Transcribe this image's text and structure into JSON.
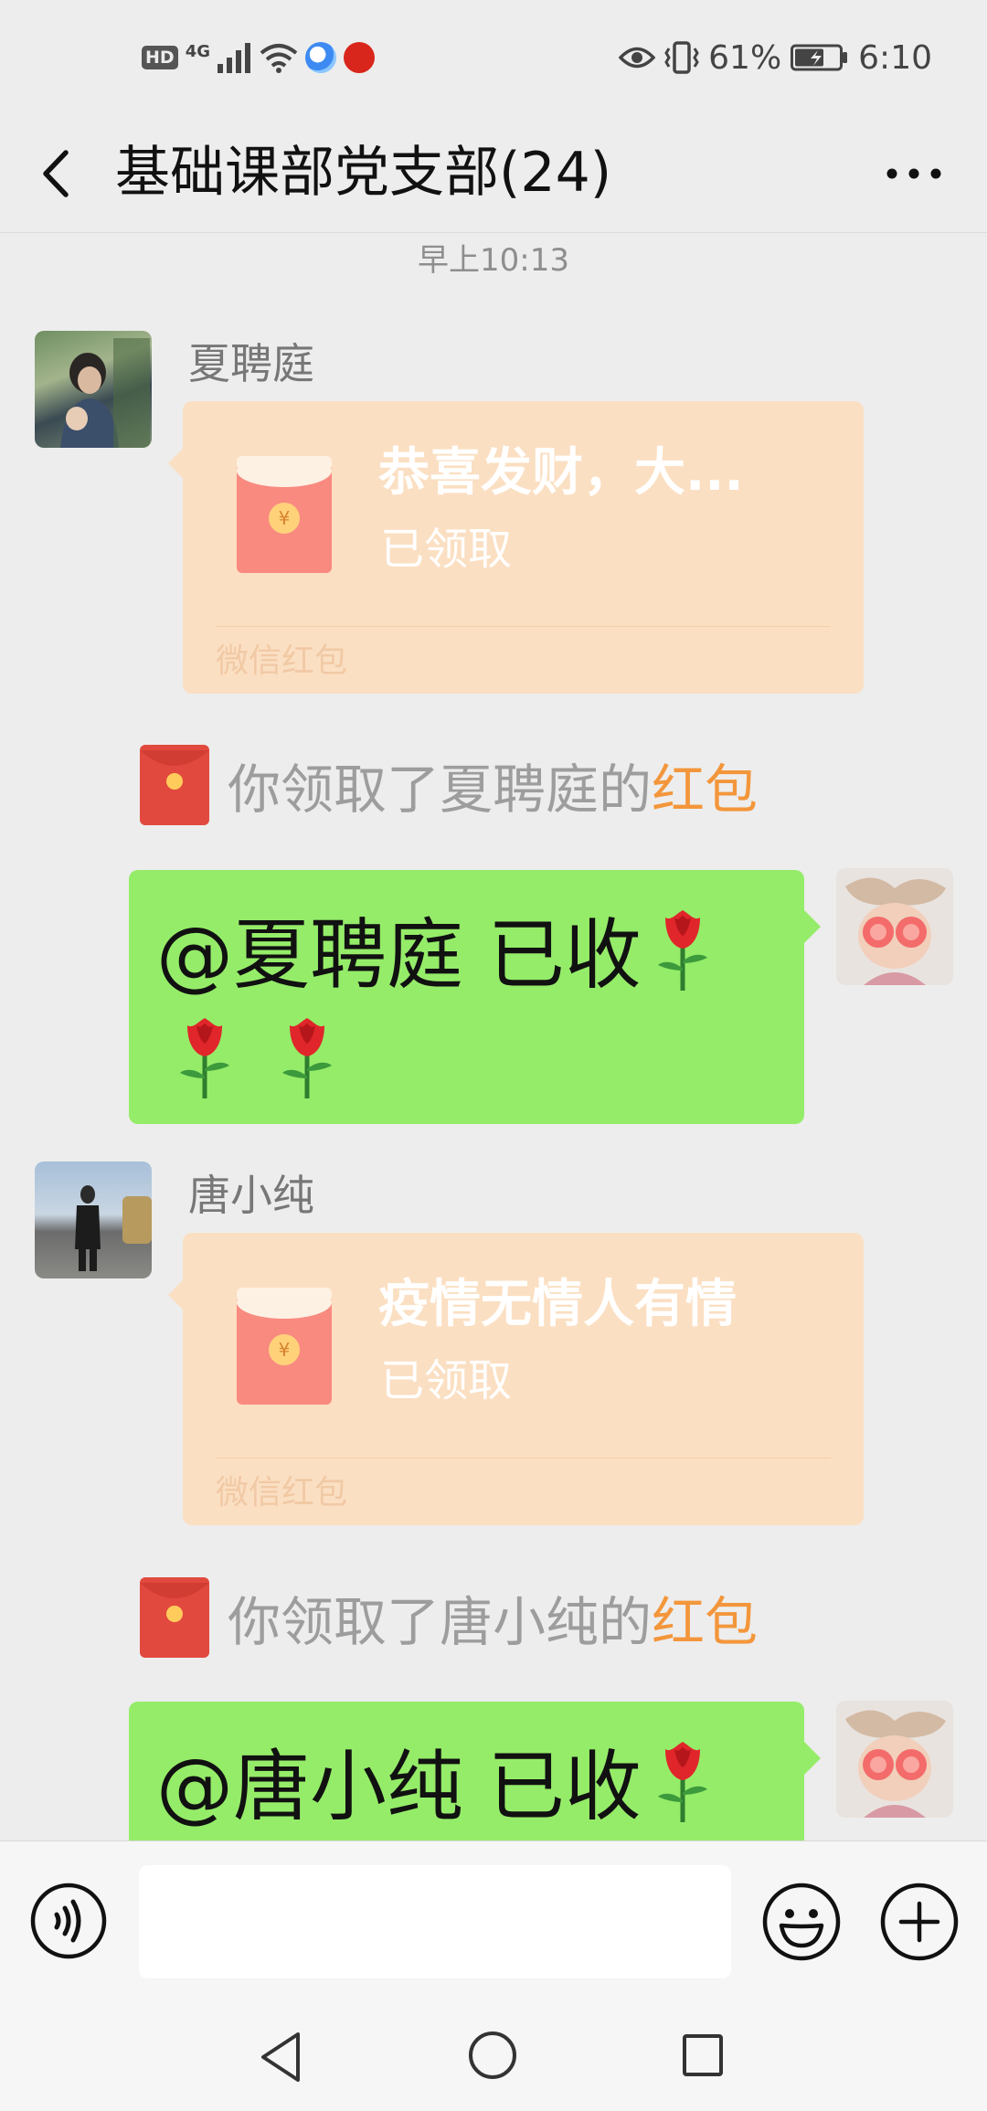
{
  "status_bar": {
    "hd": "HD",
    "network": "4G",
    "battery": "61%",
    "time": "6:10",
    "icons": [
      "signal-icon",
      "wifi-icon",
      "app-notification-icon",
      "app-notification-icon-red",
      "eye-comfort-icon",
      "vibrate-icon",
      "battery-icon"
    ]
  },
  "title_bar": {
    "title": "基础课部党支部(24)",
    "back_icon": "chevron-left-icon",
    "more_icon": "more-dots-icon"
  },
  "chat": {
    "timestamp": "早上10:13",
    "messages": [
      {
        "type": "red_packet",
        "sender": "夏聘庭",
        "title": "恭喜发财，大...",
        "status": "已领取",
        "footer": "微信红包"
      },
      {
        "type": "notice",
        "prefix": "你领取了夏聘庭的",
        "link": "红包"
      },
      {
        "type": "text",
        "line1": "@夏聘庭  已收",
        "emoji": "rose-emoji"
      },
      {
        "type": "red_packet",
        "sender": "唐小纯",
        "title": "疫情无情人有情",
        "status": "已领取",
        "footer": "微信红包"
      },
      {
        "type": "notice",
        "prefix": "你领取了唐小纯的",
        "link": "红包"
      },
      {
        "type": "text",
        "line1": "@唐小纯  已收",
        "emoji": "rose-emoji"
      }
    ]
  },
  "input_bar": {
    "value": "",
    "placeholder": ""
  },
  "colors": {
    "background": "#ededed",
    "my_bubble": "#95ec69",
    "red_packet_card": "#fbdfc2",
    "red_packet_link": "#f3963b",
    "envelope_red": "#f8877f"
  }
}
